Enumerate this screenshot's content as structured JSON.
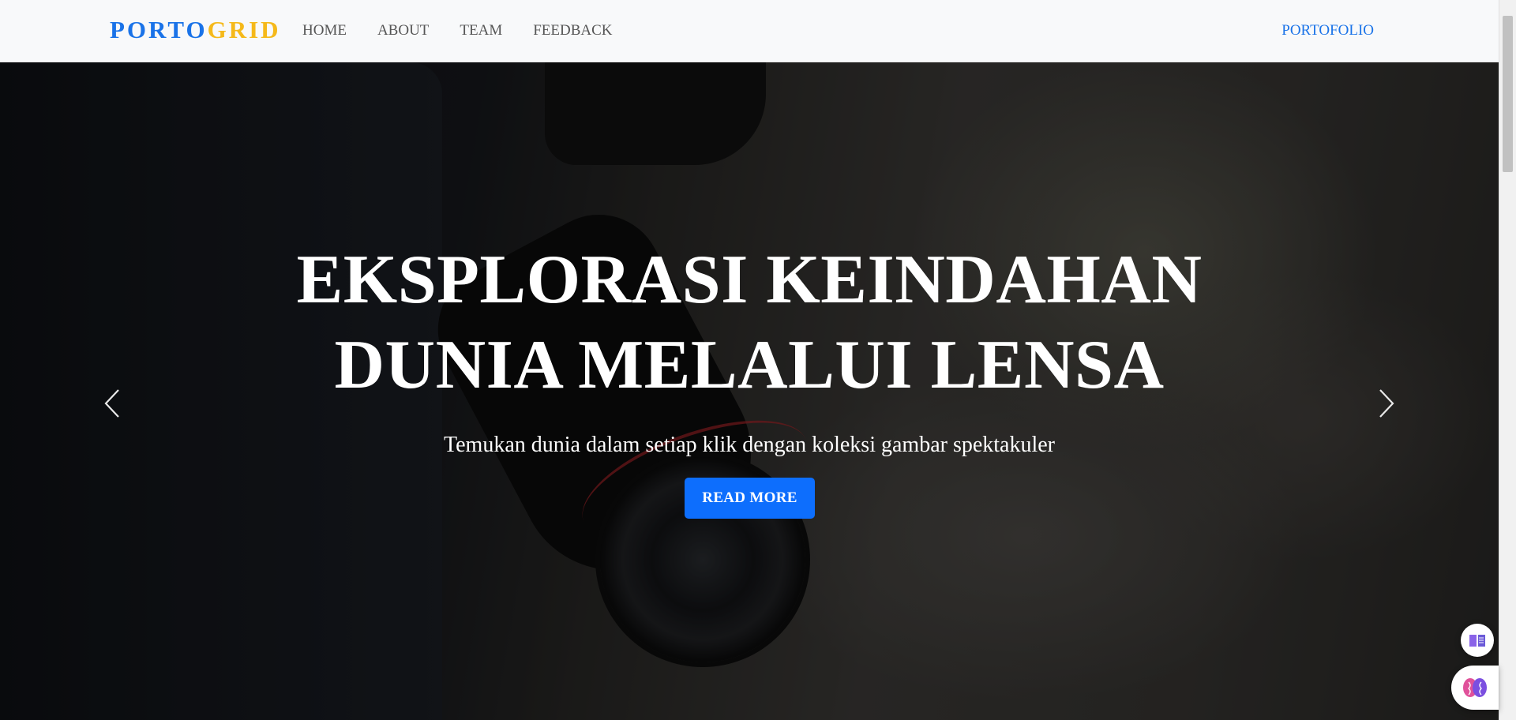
{
  "brand": {
    "part1": "PORTO",
    "part2": "GRID"
  },
  "nav": {
    "items": [
      {
        "label": "HOME"
      },
      {
        "label": "ABOUT"
      },
      {
        "label": "TEAM"
      },
      {
        "label": "FEEDBACK"
      }
    ],
    "right_link": "PORTOFOLIO"
  },
  "hero": {
    "title_line1": "EKSPLORASI KEINDAHAN",
    "title_line2": "DUNIA MELALUI LENSA",
    "subtitle": "Temukan dunia dalam setiap klik dengan koleksi gambar spektakuler",
    "button_label": "READ MORE"
  },
  "icons": {
    "prev": "chevron-left-icon",
    "next": "chevron-right-icon",
    "book": "book-icon",
    "brain": "brain-icon"
  },
  "colors": {
    "brand_primary": "#1a73e8",
    "brand_accent": "#f5b91a",
    "button": "#0d6efd",
    "navbar_bg": "#f8f9fa"
  }
}
